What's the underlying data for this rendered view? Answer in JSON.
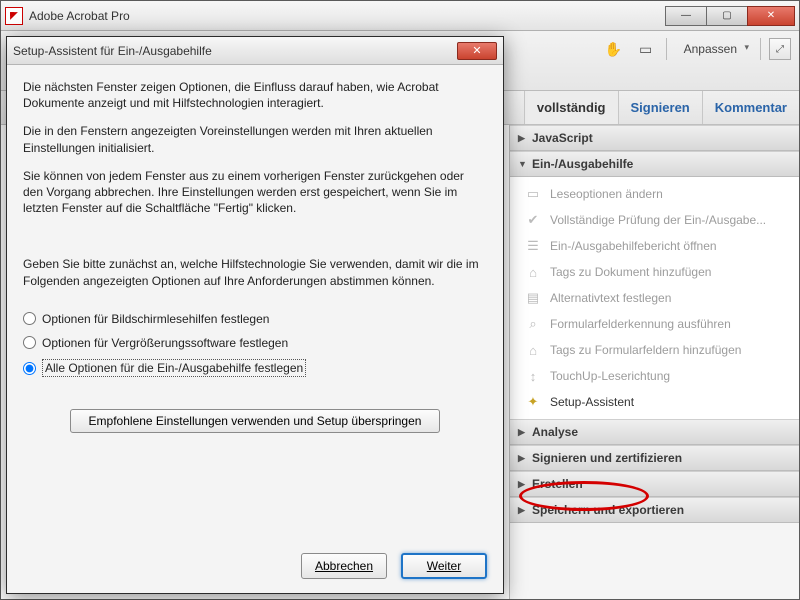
{
  "app": {
    "title": "Adobe Acrobat Pro"
  },
  "window_controls": {
    "min": "—",
    "max": "▢",
    "close": "✕"
  },
  "toolbar": {
    "customize_label": "Anpassen"
  },
  "tabs": {
    "tools": "vollständig",
    "sign": "Signieren",
    "comment": "Kommentar"
  },
  "sections": {
    "javascript": "JavaScript",
    "accessibility": "Ein-/Ausgabehilfe",
    "analyse": "Analyse",
    "sign_cert": "Signieren und zertifizieren",
    "create": "Erstellen",
    "save_export": "Speichern und exportieren"
  },
  "tools": {
    "read_options": "Leseoptionen ändern",
    "full_check": "Vollständige Prüfung der Ein-/Ausgabe...",
    "open_report": "Ein-/Ausgabehilfebericht öffnen",
    "add_tags": "Tags zu Dokument hinzufügen",
    "alt_text": "Alternativtext festlegen",
    "form_detect": "Formularfelderkennung ausführen",
    "form_tags": "Tags zu Formularfeldern hinzufügen",
    "touchup": "TouchUp-Leserichtung",
    "setup_assist": "Setup-Assistent"
  },
  "dialog": {
    "title": "Setup-Assistent für Ein-/Ausgabehilfe",
    "p1": "Die nächsten Fenster zeigen Optionen, die Einfluss darauf haben, wie Acrobat Dokumente anzeigt und mit Hilfstechnologien interagiert.",
    "p2": "Die in den Fenstern angezeigten Voreinstellungen werden mit Ihren aktuellen Einstellungen initialisiert.",
    "p3": "Sie können von jedem Fenster aus zu einem vorherigen Fenster zurückgehen oder den Vorgang abbrechen. Ihre Einstellungen werden erst gespeichert, wenn Sie im letzten Fenster auf die Schaltfläche \"Fertig\" klicken.",
    "p4": "Geben Sie bitte zunächst an, welche Hilfstechnologie Sie verwenden, damit wir die im Folgenden angezeigten Optionen auf Ihre Anforderungen abstimmen können.",
    "radio1": "Optionen für Bildschirmlesehilfen festlegen",
    "radio2": "Optionen für Vergrößerungssoftware festlegen",
    "radio3": "Alle Optionen für die Ein-/Ausgabehilfe festlegen",
    "skip_btn": "Empfohlene Einstellungen verwenden und Setup überspringen",
    "cancel": "Abbrechen",
    "next": "Weiter"
  }
}
